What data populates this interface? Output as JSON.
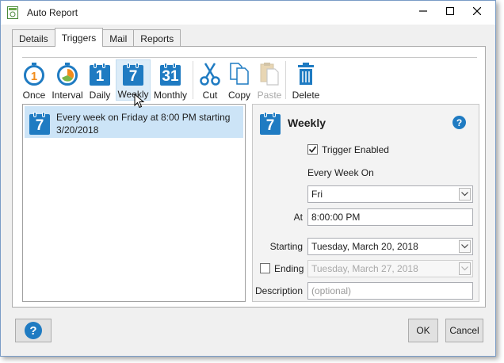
{
  "window": {
    "title": "Auto Report"
  },
  "tabs": [
    {
      "label": "Details"
    },
    {
      "label": "Triggers"
    },
    {
      "label": "Mail"
    },
    {
      "label": "Reports"
    }
  ],
  "toolbar": {
    "once": "Once",
    "interval": "Interval",
    "daily": "Daily",
    "daily_num": "1",
    "weekly": "Weekly",
    "weekly_num": "7",
    "monthly": "Monthly",
    "monthly_num": "31",
    "cut": "Cut",
    "copy": "Copy",
    "paste": "Paste",
    "delete": "Delete"
  },
  "triggers_list": [
    {
      "text": "Every week on Friday at 8:00 PM starting 3/20/2018",
      "icon_num": "7"
    }
  ],
  "detail": {
    "icon_num": "7",
    "title": "Weekly",
    "help": "?",
    "trigger_enabled_label": "Trigger Enabled",
    "trigger_enabled": true,
    "every_week_on_label": "Every Week On",
    "day_value": "Fri",
    "at_label": "At",
    "at_value": "8:00:00 PM",
    "starting_label": "Starting",
    "starting_value": "Tuesday, March 20, 2018",
    "ending_label": "Ending",
    "ending_enabled": false,
    "ending_value": "Tuesday, March 27, 2018",
    "description_label": "Description",
    "description_placeholder": "(optional)"
  },
  "footer": {
    "help": "?",
    "ok": "OK",
    "cancel": "Cancel"
  },
  "colors": {
    "accent": "#1f7bc2",
    "selection": "#cce4f7"
  }
}
